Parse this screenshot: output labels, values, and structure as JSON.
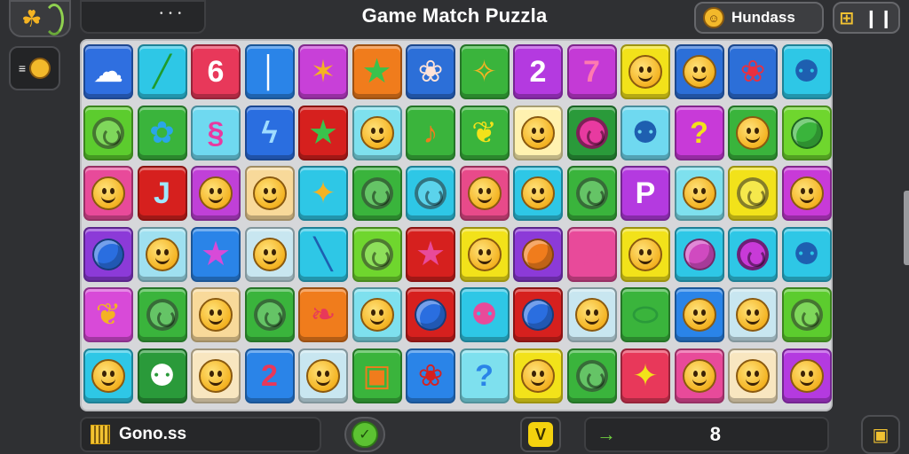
{
  "header": {
    "title": "Game Match Puzzla",
    "score_label": "Hundass",
    "left_menu_dots": "• • •"
  },
  "footer": {
    "left_label": "Gono.ss",
    "right_value": "8",
    "yellow_btn_glyph": "V",
    "right_arrow": "→"
  },
  "colors": {
    "bg": "#2f3033",
    "board": "#d6d7da",
    "accent_green": "#6fcf3f",
    "accent_yellow": "#f1c232"
  },
  "icons": {
    "top_left": "clover-icon",
    "side": "emoji-face-icon",
    "score": "emoji-face-icon",
    "top_right_1": "grid-icon",
    "top_right_2": "pause-icon",
    "bottom_left": "grid-icon",
    "corner": "box-icon"
  },
  "board": {
    "rows": 6,
    "cols": 14,
    "tiles": [
      [
        {
          "bg": "#2f6fe0",
          "kind": "cloud"
        },
        {
          "bg": "#2ec7e6",
          "kind": "text",
          "t": "╱",
          "fg": "#1f9b2c"
        },
        {
          "bg": "#e8385a",
          "kind": "text",
          "t": "6",
          "fg": "#ffffff"
        },
        {
          "bg": "#2a84e8",
          "kind": "text",
          "t": "│",
          "fg": "#ffffff"
        },
        {
          "bg": "#c840d8",
          "kind": "text",
          "t": "✶",
          "fg": "#f4b322"
        },
        {
          "bg": "#f07c1c",
          "kind": "star",
          "fg": "#3ac24c"
        },
        {
          "bg": "#2c6fd8",
          "kind": "text",
          "t": "❀",
          "fg": "#ffe3d8"
        },
        {
          "bg": "#3ab43c",
          "kind": "text",
          "t": "✧",
          "fg": "#f4b322"
        },
        {
          "bg": "#b43ae0",
          "kind": "text",
          "t": "2",
          "fg": "#ffffff"
        },
        {
          "bg": "#c43ad6",
          "kind": "text",
          "t": "7",
          "fg": "#ff7ab0"
        },
        {
          "bg": "#f2e21a",
          "kind": "face"
        },
        {
          "bg": "#2c6fd8",
          "kind": "face"
        },
        {
          "bg": "#2c6fd8",
          "kind": "text",
          "t": "❀",
          "fg": "#e83040"
        },
        {
          "bg": "#2ec7e6",
          "kind": "text",
          "t": "⚉",
          "fg": "#1e5fb0"
        }
      ],
      [
        {
          "bg": "#5ccc2e",
          "kind": "swirl"
        },
        {
          "bg": "#3ab43c",
          "kind": "text",
          "t": "✿",
          "fg": "#2aa6e8"
        },
        {
          "bg": "#6fd9f0",
          "kind": "text",
          "t": "§",
          "fg": "#e83aa0"
        },
        {
          "bg": "#2a6ee0",
          "kind": "text",
          "t": "ϟ",
          "fg": "#9fdcff"
        },
        {
          "bg": "#d6201e",
          "kind": "star",
          "fg": "#3ac24c"
        },
        {
          "bg": "#7ee0ee",
          "kind": "face"
        },
        {
          "bg": "#3ab43c",
          "kind": "text",
          "t": "♪",
          "fg": "#f07c1c"
        },
        {
          "bg": "#3ab43c",
          "kind": "text",
          "t": "❦",
          "fg": "#f2e21a"
        },
        {
          "bg": "#fff2b0",
          "kind": "face"
        },
        {
          "bg": "#2a9a3a",
          "kind": "swirl",
          "fg": "#e83aa0"
        },
        {
          "bg": "#6fd9f0",
          "kind": "text",
          "t": "⚉",
          "fg": "#1e5fb0"
        },
        {
          "bg": "#c83ad8",
          "kind": "text",
          "t": "?",
          "fg": "#f2e21a"
        },
        {
          "bg": "#3ab43c",
          "kind": "face"
        },
        {
          "bg": "#6fd62e",
          "kind": "ball",
          "fg": "#3ab43c"
        }
      ],
      [
        {
          "bg": "#e84a9a",
          "kind": "face"
        },
        {
          "bg": "#d6201e",
          "kind": "text",
          "t": "J",
          "fg": "#9fe8ff"
        },
        {
          "bg": "#c040d8",
          "kind": "face"
        },
        {
          "bg": "#f8d99a",
          "kind": "face"
        },
        {
          "bg": "#2ec7e6",
          "kind": "text",
          "t": "✦",
          "fg": "#f4b322"
        },
        {
          "bg": "#3ab43c",
          "kind": "swirl"
        },
        {
          "bg": "#2ec7e6",
          "kind": "swirl"
        },
        {
          "bg": "#e84a8a",
          "kind": "face"
        },
        {
          "bg": "#2ec7e6",
          "kind": "face"
        },
        {
          "bg": "#3ab43c",
          "kind": "swirl"
        },
        {
          "bg": "#b43ae0",
          "kind": "text",
          "t": "P",
          "fg": "#ffffff"
        },
        {
          "bg": "#7ee0ee",
          "kind": "face"
        },
        {
          "bg": "#f2e21a",
          "kind": "swirl"
        },
        {
          "bg": "#c83ad8",
          "kind": "face"
        }
      ],
      [
        {
          "bg": "#8c3ad8",
          "kind": "ball",
          "fg": "#2a6ee0"
        },
        {
          "bg": "#9fe0f0",
          "kind": "face"
        },
        {
          "bg": "#2a84e8",
          "kind": "star",
          "fg": "#d84ad8"
        },
        {
          "bg": "#c8e6f0",
          "kind": "face"
        },
        {
          "bg": "#2ec7e6",
          "kind": "text",
          "t": "╲",
          "fg": "#1e5fb0"
        },
        {
          "bg": "#6fd62e",
          "kind": "swirl"
        },
        {
          "bg": "#d6201e",
          "kind": "star",
          "fg": "#e84a9a"
        },
        {
          "bg": "#f2e21a",
          "kind": "face"
        },
        {
          "bg": "#8c3ad8",
          "kind": "ball",
          "fg": "#f07c1c"
        },
        {
          "bg": "#e84a9a",
          "kind": "star",
          "fg": "#e84a9a"
        },
        {
          "bg": "#f2e21a",
          "kind": "face"
        },
        {
          "bg": "#2ec7e6",
          "kind": "ball",
          "fg": "#d04ac0"
        },
        {
          "bg": "#2ec7e6",
          "kind": "swirl",
          "fg": "#c83ad8"
        },
        {
          "bg": "#2ec7e6",
          "kind": "text",
          "t": "⚉",
          "fg": "#1e5fb0"
        }
      ],
      [
        {
          "bg": "#d84ad8",
          "kind": "text",
          "t": "❦",
          "fg": "#f4b322"
        },
        {
          "bg": "#3ab43c",
          "kind": "swirl"
        },
        {
          "bg": "#f8d99a",
          "kind": "face"
        },
        {
          "bg": "#3ab43c",
          "kind": "swirl"
        },
        {
          "bg": "#f07c1c",
          "kind": "text",
          "t": "❧",
          "fg": "#e8385a"
        },
        {
          "bg": "#7ee0ee",
          "kind": "face"
        },
        {
          "bg": "#d6201e",
          "kind": "ball",
          "fg": "#2a6ee0"
        },
        {
          "bg": "#2ec7e6",
          "kind": "text",
          "t": "⚉",
          "fg": "#e84a9a"
        },
        {
          "bg": "#d6201e",
          "kind": "ball",
          "fg": "#2a6ee0"
        },
        {
          "bg": "#c8e6f0",
          "kind": "face"
        },
        {
          "bg": "#3ab43c",
          "kind": "text",
          "t": "⬭",
          "fg": "#2a9a3a"
        },
        {
          "bg": "#2a84e8",
          "kind": "face"
        },
        {
          "bg": "#c8e6f0",
          "kind": "face"
        },
        {
          "bg": "#5ccc2e",
          "kind": "swirl"
        }
      ],
      [
        {
          "bg": "#2ec7e6",
          "kind": "face"
        },
        {
          "bg": "#2a9a3a",
          "kind": "text",
          "t": "⚉",
          "fg": "#ffffff"
        },
        {
          "bg": "#f8e6c0",
          "kind": "face"
        },
        {
          "bg": "#2a84e8",
          "kind": "text",
          "t": "2",
          "fg": "#e8385a"
        },
        {
          "bg": "#c8e6f0",
          "kind": "face"
        },
        {
          "bg": "#3ab43c",
          "kind": "text",
          "t": "▣",
          "fg": "#f07c1c"
        },
        {
          "bg": "#2a84e8",
          "kind": "text",
          "t": "❀",
          "fg": "#d6201e"
        },
        {
          "bg": "#7ee0ee",
          "kind": "text",
          "t": "?",
          "fg": "#2a84e8"
        },
        {
          "bg": "#f2e21a",
          "kind": "face"
        },
        {
          "bg": "#3ab43c",
          "kind": "swirl"
        },
        {
          "bg": "#e8385a",
          "kind": "text",
          "t": "✦",
          "fg": "#f2e21a"
        },
        {
          "bg": "#e84a9a",
          "kind": "face"
        },
        {
          "bg": "#f8e6c0",
          "kind": "face"
        },
        {
          "bg": "#b43ae0",
          "kind": "face"
        }
      ]
    ]
  }
}
